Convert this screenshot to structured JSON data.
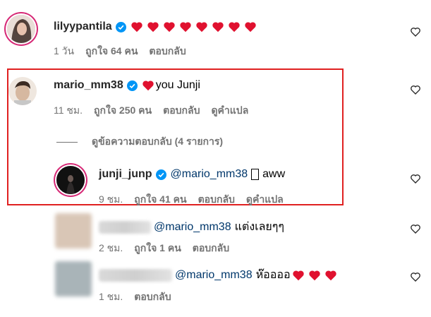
{
  "comments": [
    {
      "username": "lilyypantila",
      "verified": true,
      "text": "",
      "hearts": 8,
      "time": "1 วัน",
      "likes": "ถูกใจ 64 คน",
      "reply": "ตอบกลับ"
    },
    {
      "username": "mario_mm38",
      "verified": true,
      "text": "you Junji",
      "hearts": 1,
      "time": "11 ชม.",
      "likes": "ถูกใจ 250 คน",
      "reply": "ตอบกลับ",
      "translate": "ดูคำแปล"
    },
    {
      "username": "junji_junp",
      "verified": true,
      "mention": "@mario_mm38",
      "text": "aww",
      "time": "9 ชม.",
      "likes": "ถูกใจ 41 คน",
      "reply": "ตอบกลับ",
      "translate": "ดูคำแปล"
    },
    {
      "username": "",
      "mention": "@mario_mm38",
      "text": "แต่งเลยๆๆ",
      "time": "2 ชม.",
      "likes": "ถูกใจ 1 คน",
      "reply": "ตอบกลับ"
    },
    {
      "username": "",
      "mention": "@mario_mm38",
      "text": "ห๊ออออ",
      "hearts": 3,
      "time": "1 ชม.",
      "reply": "ตอบกลับ"
    }
  ],
  "view_replies": "ดูข้อความตอบกลับ (4 รายการ)",
  "colors": {
    "heart": "#e0112f",
    "verified": "#0095f6",
    "highlight": "#e02020"
  }
}
